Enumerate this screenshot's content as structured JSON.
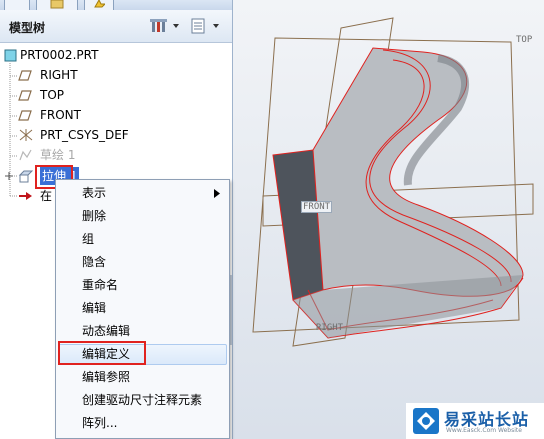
{
  "panel": {
    "title": "模型树"
  },
  "tree": {
    "items": [
      {
        "label": "PRT0002.PRT",
        "icon": "part-icon"
      },
      {
        "label": "RIGHT",
        "icon": "datum-plane-icon"
      },
      {
        "label": "TOP",
        "icon": "datum-plane-icon"
      },
      {
        "label": "FRONT",
        "icon": "datum-plane-icon"
      },
      {
        "label": "PRT_CSYS_DEF",
        "icon": "coordinate-system-icon"
      },
      {
        "label": "草绘 1",
        "icon": "sketch-icon"
      },
      {
        "label": "拉伸 1",
        "icon": "extrude-icon"
      },
      {
        "label": "在",
        "icon": "insert-here-arrow-icon"
      }
    ]
  },
  "context_menu": {
    "items": [
      "表示",
      "删除",
      "组",
      "隐含",
      "重命名",
      "编辑",
      "动态编辑",
      "编辑定义",
      "编辑参照",
      "创建驱动尺寸注释元素",
      "阵列..."
    ],
    "highlighted": "编辑定义"
  },
  "viewport": {
    "labels": {
      "top": "TOP",
      "front": "FRONT",
      "right": "RIGHT"
    }
  },
  "watermark": {
    "text": "易采站长站",
    "subtext": "Www.Easck.Com Website"
  },
  "colors": {
    "highlight_red": "#e0221f",
    "datum_brown": "#8b6f4e",
    "model_gray": "#9a9ea3",
    "selection_blue": "#3a6fd6"
  }
}
